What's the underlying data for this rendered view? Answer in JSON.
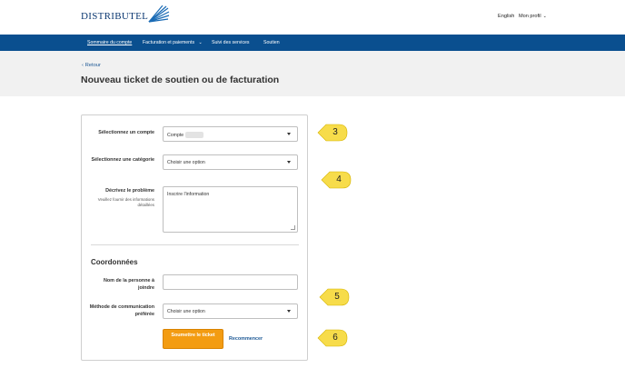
{
  "header": {
    "logo_text": "DISTRIBUTEL",
    "language": "English",
    "profile": "Mon profil"
  },
  "nav": {
    "items": [
      {
        "label": "Sommaire du compte",
        "active": true
      },
      {
        "label": "Facturation et paiements",
        "dropdown": true
      },
      {
        "label": "Suivi des services"
      },
      {
        "label": "Soutien"
      }
    ]
  },
  "page": {
    "back_label": "Retour",
    "title": "Nouveau ticket de soutien ou de facturation"
  },
  "form": {
    "account": {
      "label": "Sélectionnez un compte",
      "value": "Compte"
    },
    "category": {
      "label": "Sélectionnez une catégorie",
      "value": "Choisir une option"
    },
    "description": {
      "label": "Décrivez le problème",
      "sublabel": "Veuillez fournir des informations détaillées",
      "placeholder": "Inscrire l'information"
    },
    "contact_section": "Coordonnées",
    "contact_name": {
      "label": "Nom de la personne à joindre",
      "value": ""
    },
    "contact_method": {
      "label": "Méthode de communication préférée",
      "value": "Choisir une option"
    },
    "submit_label": "Soumettre le ticket",
    "reset_label": "Recommencer"
  },
  "callouts": [
    "3",
    "4",
    "5",
    "6"
  ],
  "colors": {
    "nav_bg": "#0a4f8f",
    "submit_bg": "#f39c12",
    "callout_bg": "#f7dc4a",
    "link": "#1f5a96"
  }
}
